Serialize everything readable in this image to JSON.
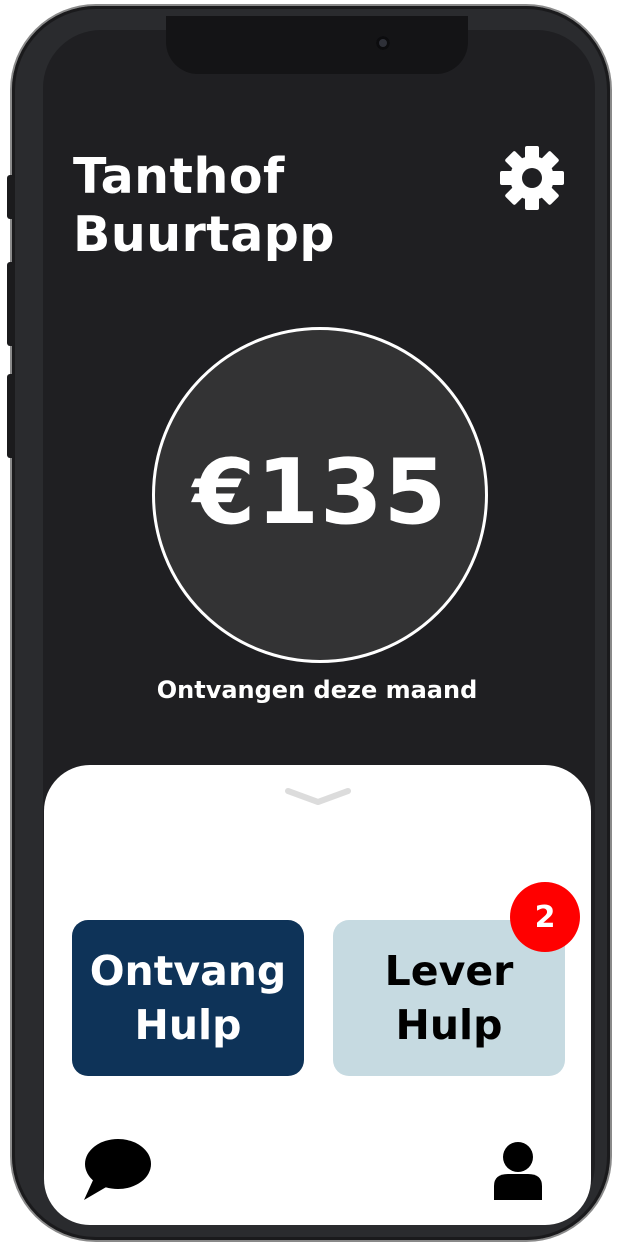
{
  "header": {
    "title_line1": "Tanthof",
    "title_line2": "Buurtapp"
  },
  "balance": {
    "amount": "€135",
    "caption": "Ontvangen deze maand"
  },
  "actions": {
    "receive": {
      "line1": "Ontvang",
      "line2": "Hulp"
    },
    "deliver": {
      "line1": "Lever",
      "line2": "Hulp",
      "badge": "2"
    }
  },
  "icons": {
    "settings": "gear-icon",
    "handle": "chevron-down-icon",
    "chat": "chat-bubble-icon",
    "profile": "user-icon"
  },
  "colors": {
    "background": "#1f1f22",
    "circle": "#333334",
    "receive_button": "#0e3358",
    "deliver_button": "#c6dae1",
    "badge": "#ff0000"
  }
}
